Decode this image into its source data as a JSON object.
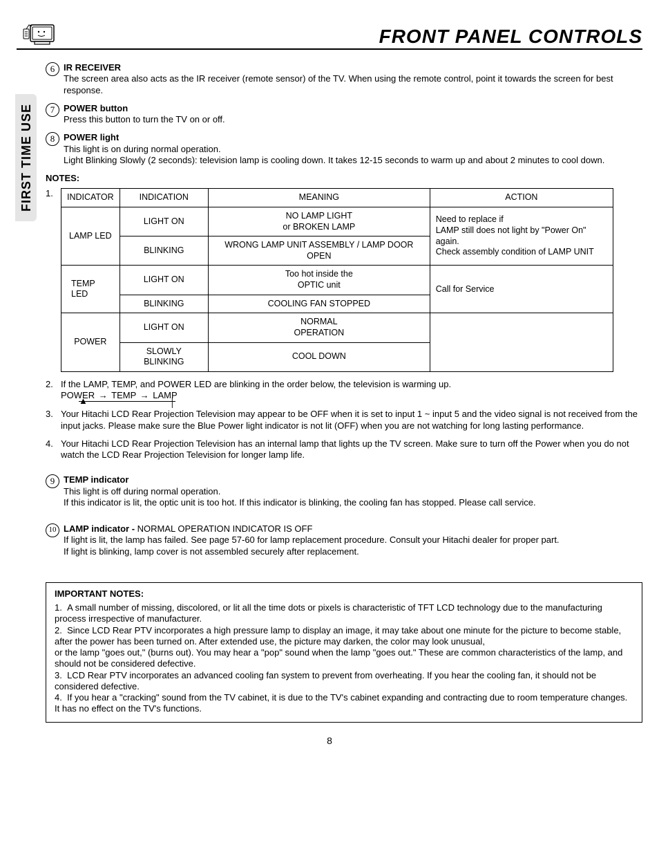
{
  "sideTab": "FIRST TIME USE",
  "headerTitle": "FRONT PANEL CONTROLS",
  "items": [
    {
      "num": "6",
      "title": "IR RECEIVER",
      "body": "The screen area also acts as the IR receiver (remote sensor) of the TV.  When using the remote control, point it towards the screen for best response."
    },
    {
      "num": "7",
      "title": "POWER button",
      "body": "Press this button to turn the TV on or off."
    },
    {
      "num": "8",
      "title": "POWER light",
      "body": "This light is on during normal operation.\nLight Blinking Slowly (2 seconds):  television lamp is cooling down.  It takes 12-15 seconds to warm up and about 2 minutes to cool down."
    }
  ],
  "notesLabel": "NOTES:",
  "table": {
    "headers": [
      "INDICATOR",
      "INDICATION",
      "MEANING",
      "ACTION"
    ],
    "row1": {
      "ind": "LAMP LED",
      "r1_ind": "LIGHT ON",
      "r1_mean": "NO LAMP LIGHT\nor BROKEN LAMP",
      "r2_ind": "BLINKING",
      "r2_mean": "WRONG LAMP UNIT ASSEMBLY / LAMP DOOR OPEN",
      "action": "Need to replace if\nLAMP still does not light by \"Power On\" again.\nCheck assembly condition of LAMP UNIT"
    },
    "row2": {
      "ind": "TEMP\nLED",
      "r1_ind": "LIGHT ON",
      "r1_mean": "Too hot inside the\nOPTIC unit",
      "r2_ind": "BLINKING",
      "r2_mean": "COOLING FAN STOPPED",
      "action": "Call for Service"
    },
    "row3": {
      "ind": "POWER",
      "r1_ind": "LIGHT ON",
      "r1_mean": "NORMAL\nOPERATION",
      "r2_ind": "SLOWLY BLINKING",
      "r2_mean": "COOL DOWN"
    }
  },
  "note2": "If the LAMP, TEMP, and POWER LED are blinking in the order below, the television is warming up.",
  "seq": {
    "p": "POWER",
    "t": "TEMP",
    "l": "LAMP"
  },
  "note3": "Your Hitachi LCD Rear Projection Television may appear to be OFF when it is set to input 1 ~ input 5 and the video signal is not received from the input jacks.  Please make sure the Blue Power light indicator is not lit (OFF) when you are not watching for long lasting performance.",
  "note4": "Your Hitachi LCD Rear Projection Television has an internal lamp that lights up the TV screen.  Make sure to turn off the Power when you do not watch the LCD Rear Projection Television for longer lamp life.",
  "item9": {
    "num": "9",
    "title": "TEMP indicator",
    "l1": "This light is off during normal operation.",
    "l2": "If this indicator is lit, the optic unit is too hot.  If this indicator is blinking, the cooling fan has stopped.  Please call service."
  },
  "item10": {
    "num": "10",
    "titleBold": "LAMP indicator - ",
    "titleRest": "NORMAL OPERATION INDICATOR IS OFF",
    "l1": "If light is lit, the lamp has failed.  See page 57-60 for lamp replacement procedure.  Consult your Hitachi dealer for proper part.",
    "l2": "If light is blinking, lamp cover is not assembled securely after replacement."
  },
  "important": {
    "hdr": "IMPORTANT NOTES:",
    "n1": "A small number of missing, discolored, or lit all the time dots or pixels is characteristic of TFT LCD technology due to the manufacturing process irrespective of manufacturer.",
    "n2": "Since LCD Rear PTV incorporates a high pressure lamp to display an image, it may take about one minute for the picture to become stable, after the power has been turned on.  After extended use, the picture may darken, the color may look unusual,",
    "n2b": "or the lamp \"goes out,\" (burns out).  You may hear a \"pop\" sound when the lamp \"goes out.\"  These are common characteristics of the lamp, and should not be considered defective.",
    "n3": "LCD Rear PTV incorporates an advanced cooling fan system to prevent from overheating.  If you hear the cooling fan, it should not be considered defective.",
    "n4": "If you hear a \"cracking\" sound from the TV cabinet, it is due to the TV's cabinet expanding and contracting due to room temperature changes.  It has no effect on the TV's functions."
  },
  "pageNum": "8"
}
